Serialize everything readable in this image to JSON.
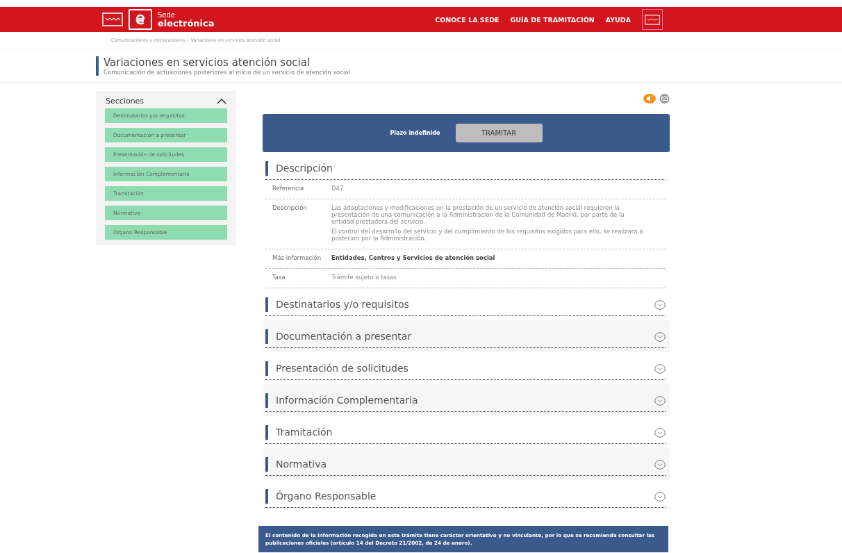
{
  "header": {
    "logo_text": [
      "Sede",
      "electrónica"
    ],
    "nav": [
      "CONOCE LA SEDE",
      "GUÍA DE TRAMITACIÓN",
      "AYUDA"
    ]
  },
  "breadcrumb_separator": "/",
  "breadcrumb": [
    "Comunicaciones y declaraciones",
    "Variaciones en servicios atención social"
  ],
  "page": {
    "title": "Variaciones en servicios atención social",
    "subtitle": "Comunicación de actuaciones posteriores al inicio de un servicio de atención social"
  },
  "sidebar": {
    "title": "Secciones",
    "expanded": true,
    "items": [
      "Destinatarios y/o requisitos",
      "Documentación a presentar",
      "Presentación de solicitudes",
      "Información Complementaria",
      "Tramitación",
      "Normativa",
      "Órgano Responsable"
    ]
  },
  "action_box": {
    "deadline": "Plazo indefinido",
    "button": "TRAMITAR"
  },
  "description": {
    "title": "Descripción",
    "rows": [
      {
        "kind": "text",
        "label": "Referencia",
        "values": [
          "D47"
        ]
      },
      {
        "kind": "text",
        "label": "Descripción",
        "values": [
          "Las adaptaciones y modificaciones en la prestación de un servicio de atención social requieren la presentación de una comunicación a la Administración de la Comunidad de Madrid, por parte de la entidad prestadora del servicio.",
          "El control del desarrollo del servicio y del cumplimiento de los requisitos exigidos para ello, se realizará a posteriori por la Administración."
        ]
      },
      {
        "kind": "link",
        "label": "Más información",
        "values": [
          "Entidades, Centros y Servicios de atención social"
        ]
      },
      {
        "kind": "text",
        "label": "Tasa",
        "values": [
          "Trámite sujeto a tasas"
        ]
      }
    ]
  },
  "sections": [
    {
      "title": "Destinatarios y/o requisitos",
      "expanded": false
    },
    {
      "title": "Documentación a presentar",
      "expanded": false
    },
    {
      "title": "Presentación de solicitudes",
      "expanded": false
    },
    {
      "title": "Información Complementaria",
      "expanded": false
    },
    {
      "title": "Tramitación",
      "expanded": false
    },
    {
      "title": "Normativa",
      "expanded": false
    },
    {
      "title": "Órgano Responsable",
      "expanded": false
    }
  ],
  "notice": "El contenido de la información recogida en este trámite tiene carácter orientativo y no vinculante, por lo que se recomienda consultar las publicaciones oficiales (artículo 14 del Decreto 21/2002, de 24 de enero)."
}
